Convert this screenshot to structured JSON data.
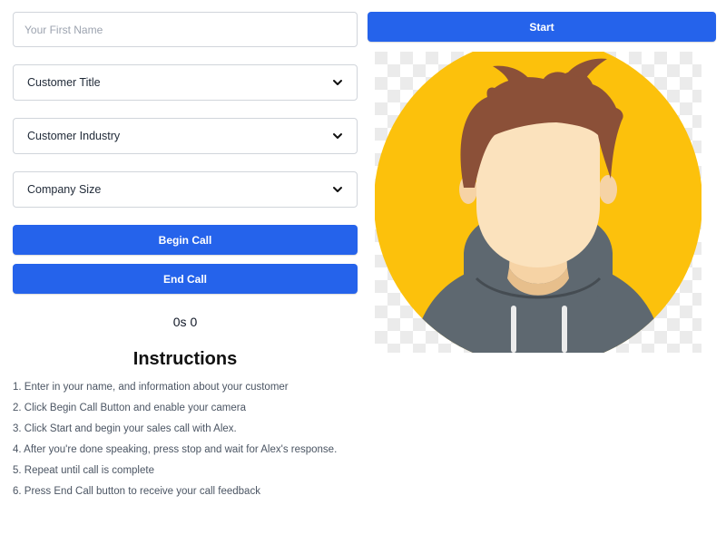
{
  "form": {
    "first_name_placeholder": "Your First Name",
    "first_name_value": "",
    "customer_title": "Customer Title",
    "customer_industry": "Customer Industry",
    "company_size": "Company Size"
  },
  "buttons": {
    "begin_call": "Begin Call",
    "end_call": "End Call",
    "start": "Start"
  },
  "timer": {
    "text": "0s 0"
  },
  "instructions": {
    "title": "Instructions",
    "items": [
      "1. Enter in your name, and information about your customer",
      "2. Click Begin Call Button and enable your camera",
      "3. Click Start and begin your sales call with Alex.",
      "4. After you're done speaking, press stop and wait for Alex's response.",
      "5. Repeat until call is complete",
      "6. Press End Call button to receive your call feedback"
    ]
  },
  "icons": {
    "select_chevron": "chevron-down-icon",
    "avatar": "person-avatar-icon"
  },
  "colors": {
    "primary_button": "#2563eb",
    "avatar_background": "#fcc10c",
    "hoodie": "#5e6870",
    "hair": "#8b5038",
    "skin": "#fbe2bd"
  }
}
